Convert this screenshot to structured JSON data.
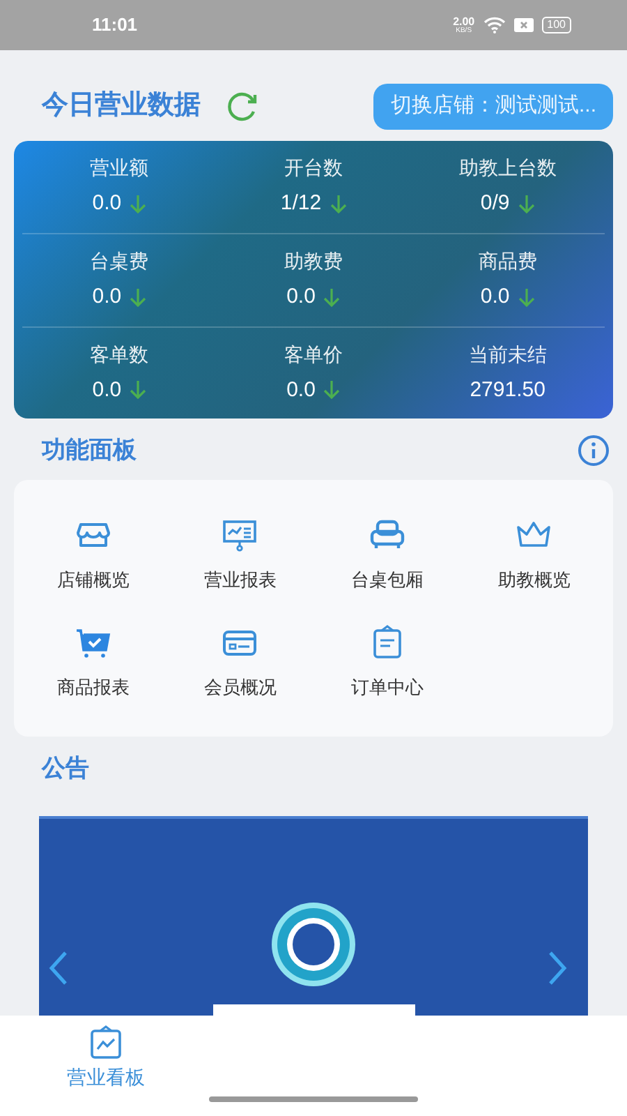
{
  "status_bar": {
    "time": "11:01",
    "speed": "2.00",
    "speed_unit": "KB/S",
    "battery": "100"
  },
  "header": {
    "title": "今日营业数据",
    "store_button": "切换店铺：测试测试..."
  },
  "stats": [
    {
      "label": "营业额",
      "value": "0.0",
      "kind": "falling"
    },
    {
      "label": "开台数",
      "value": "1/12",
      "kind": "falling"
    },
    {
      "label": "助教上台数",
      "value": "0/9",
      "kind": "falling"
    },
    {
      "label": "台桌费",
      "value": "0.0",
      "kind": "falling"
    },
    {
      "label": "助教费",
      "value": "0.0",
      "kind": "falling"
    },
    {
      "label": "商品费",
      "value": "0.0",
      "kind": "falling"
    },
    {
      "label": "客单数",
      "value": "0.0",
      "kind": "falling"
    },
    {
      "label": "客单价",
      "value": "0.0",
      "kind": "falling"
    },
    {
      "label": "当前未结",
      "value": "2791.50",
      "kind": "plain"
    }
  ],
  "function_panel": {
    "title": "功能面板",
    "items": [
      {
        "label": "店铺概览"
      },
      {
        "label": "营业报表"
      },
      {
        "label": "台桌包厢"
      },
      {
        "label": "助教概览"
      },
      {
        "label": "商品报表"
      },
      {
        "label": "会员概况"
      },
      {
        "label": "订单中心"
      }
    ]
  },
  "notice": {
    "title": "公告"
  },
  "bottom_nav": [
    {
      "label": "营业看板",
      "selected": true
    }
  ]
}
